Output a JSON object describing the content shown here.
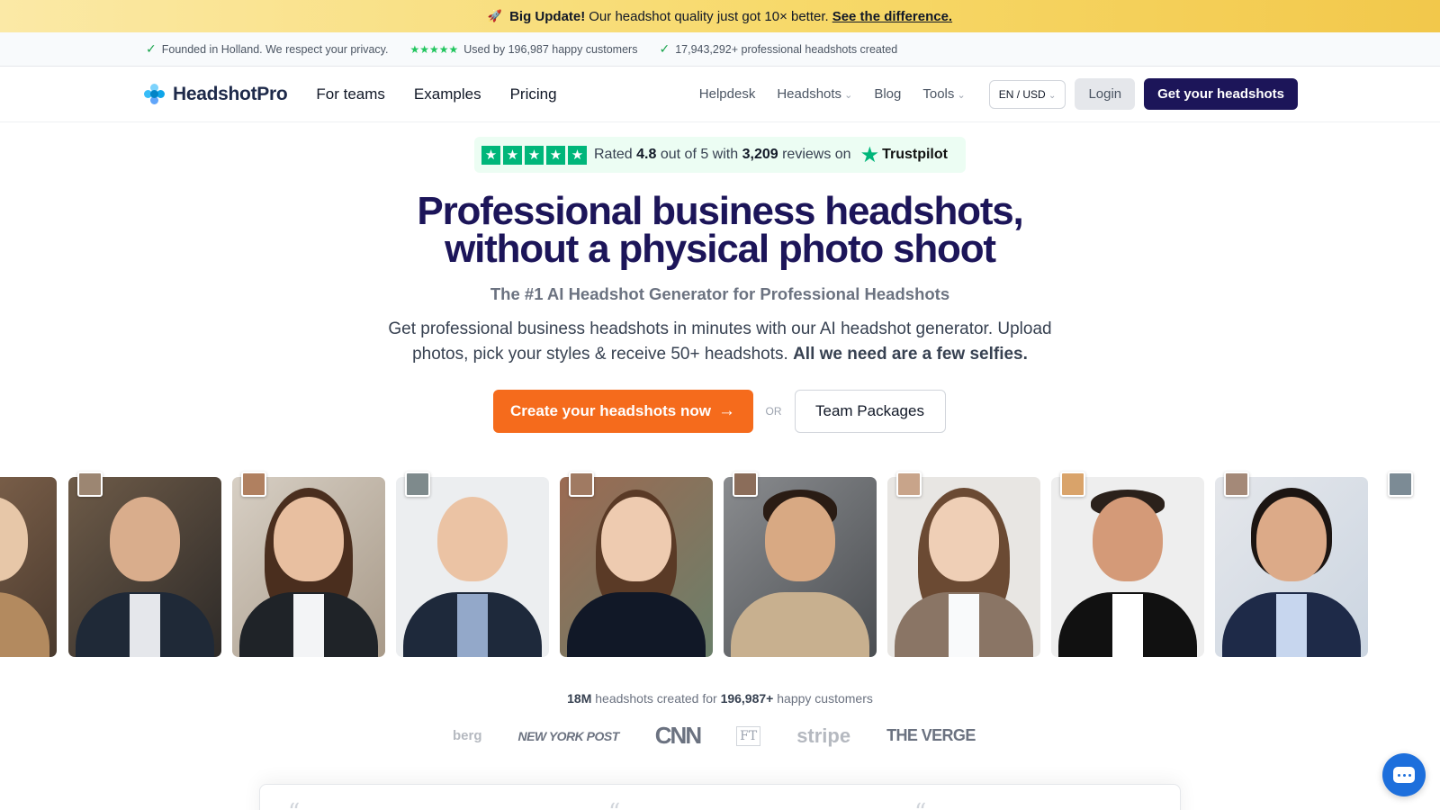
{
  "announcement": {
    "icon": "rocket-icon",
    "lead": "Big Update!",
    "text": "Our headshot quality just got 10× better.",
    "link": "See the difference."
  },
  "trust_strip": {
    "items": [
      "Founded in Holland. We respect your privacy.",
      "Used by 196,987 happy customers",
      "17,943,292+ professional headshots created"
    ]
  },
  "nav": {
    "logo": "HeadshotPro",
    "main": [
      "For teams",
      "Examples",
      "Pricing"
    ],
    "right": [
      "Helpdesk",
      "Headshots",
      "Blog",
      "Tools"
    ],
    "lang": "EN / USD",
    "login": "Login",
    "cta": "Get your headshots"
  },
  "trustpilot": {
    "rated": "Rated",
    "score": "4.8",
    "out_of": "out of 5 with",
    "count": "3,209",
    "reviews_on": "reviews on",
    "brand": "Trustpilot",
    "stars": 5
  },
  "hero": {
    "title_line1": "Professional business headshots,",
    "title_line2": "without a physical photo shoot",
    "subtitle": "The #1 AI Headshot Generator for Professional Headshots",
    "desc": "Get professional business headshots in minutes with our AI headshot generator. Upload photos, pick your styles & receive 50+ headshots.",
    "desc_bold": "All we need are a few selfies.",
    "cta_primary": "Create your headshots now",
    "or": "OR",
    "cta_secondary": "Team Packages"
  },
  "press": {
    "count": "18M",
    "mid": "headshots created for",
    "customers": "196,987+",
    "end": "happy customers",
    "logos": [
      "berg",
      "NEW YORK POST",
      "CNN",
      "FT",
      "stripe",
      "THE VERGE"
    ]
  },
  "colors": {
    "brand_navy": "#1c1559",
    "cta_orange": "#f56b1c",
    "trustpilot_green": "#00b67a",
    "chat_blue": "#1d6fdc"
  }
}
